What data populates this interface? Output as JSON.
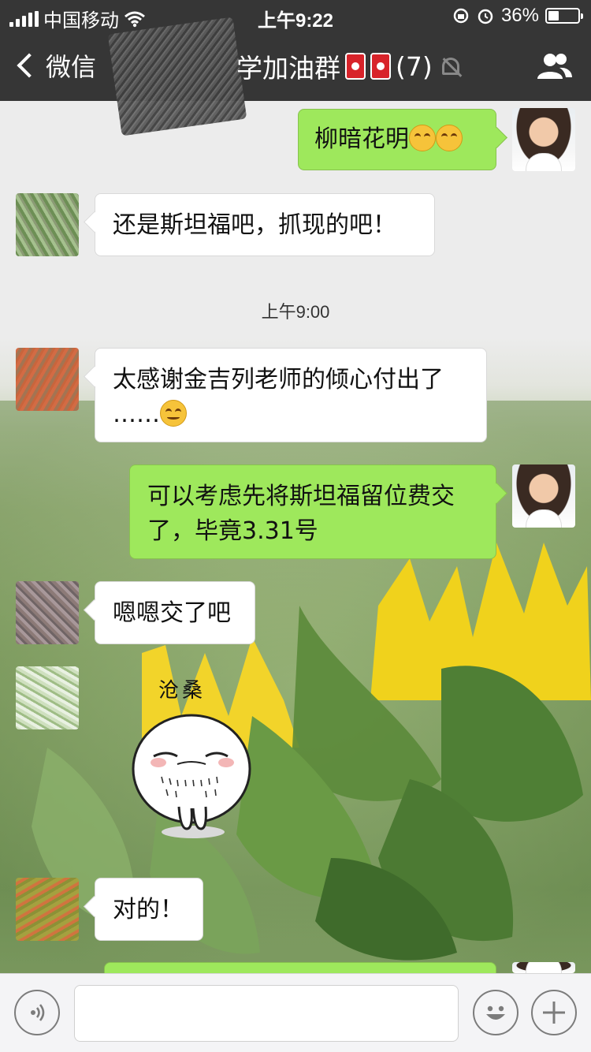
{
  "status_bar": {
    "carrier": "中国移动",
    "time": "上午9:22",
    "battery": "36%",
    "battery_level": 0.36
  },
  "nav": {
    "back_label": "微信",
    "title": "学加油群",
    "member_count": "(7)"
  },
  "chat": {
    "messages": [
      {
        "sender": "me",
        "text": "柳暗花明"
      },
      {
        "sender": "other",
        "text": "还是斯坦福吧，抓现的吧！"
      },
      {
        "sender": "other",
        "text": "太感谢金吉列老师的倾心付出了",
        "text2": "……"
      },
      {
        "sender": "me",
        "text": "可以考虑先将斯坦福留位费交",
        "text2": "了，毕竟3.31号"
      },
      {
        "sender": "other",
        "text": "嗯嗯交了吧"
      },
      {
        "sender": "other",
        "sticker_caption": "沧桑"
      },
      {
        "sender": "other",
        "text": "对的！"
      }
    ],
    "timestamp": "上午9:00"
  },
  "colors": {
    "header_bg": "#363636",
    "me_bubble": "#9ee85c",
    "other_bubble": "#ffffff"
  },
  "icons": [
    "signal-icon",
    "wifi-icon",
    "lock-rotation-icon",
    "alarm-icon",
    "battery-icon",
    "back-chevron-icon",
    "fuel-pump-icon",
    "mute-icon",
    "group-members-icon",
    "voice-icon",
    "emoji-icon",
    "plus-icon"
  ]
}
